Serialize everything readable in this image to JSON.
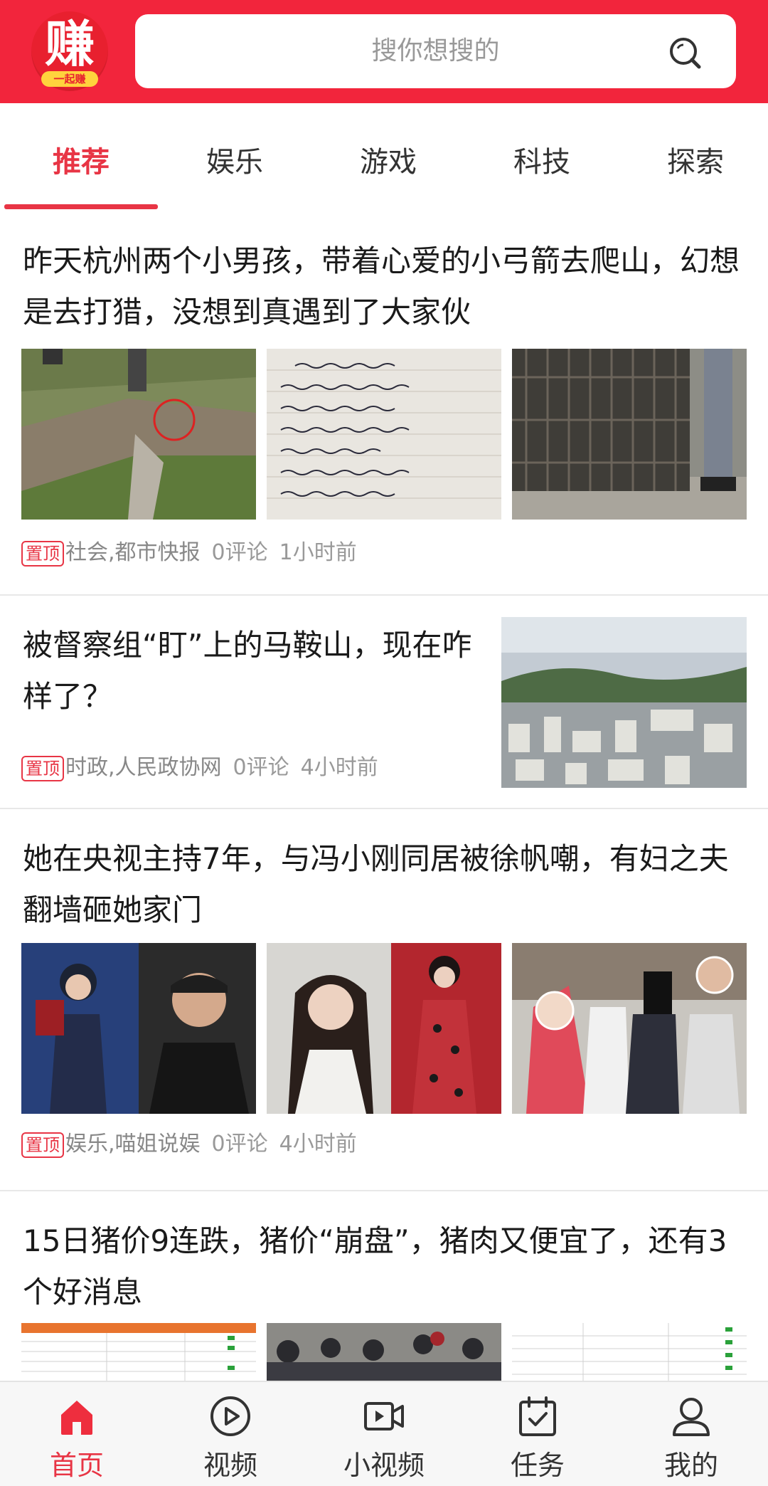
{
  "header": {
    "logo_main": "赚",
    "logo_sub": "一起赚",
    "search_placeholder": "搜你想搜的"
  },
  "tabs": [
    {
      "label": "推荐",
      "active": true
    },
    {
      "label": "娱乐",
      "active": false
    },
    {
      "label": "游戏",
      "active": false
    },
    {
      "label": "科技",
      "active": false
    },
    {
      "label": "探索",
      "active": false
    }
  ],
  "articles": [
    {
      "title": "昨天杭州两个小男孩，带着心爱的小弓箭去爬山，幻想是去打猎，没想到真遇到了大家伙",
      "badge": "置顶",
      "source": "社会,都市快报",
      "comments": "0评论",
      "time": "1小时前"
    },
    {
      "title": "被督察组“盯”上的马鞍山，现在咋样了？",
      "badge": "置顶",
      "source": "时政,人民政协网",
      "comments": "0评论",
      "time": "4小时前"
    },
    {
      "title": "她在央视主持7年，与冯小刚同居被徐帆嘲，有妇之夫翻墙砸她家门",
      "badge": "置顶",
      "source": "娱乐,喵姐说娱",
      "comments": "0评论",
      "time": "4小时前"
    },
    {
      "title": "15日猪价9连跌，猪价“崩盘”，猪肉又便宜了，还有3个好消息"
    }
  ],
  "bottom_nav": [
    {
      "label": "首页",
      "icon": "home-icon",
      "active": true
    },
    {
      "label": "视频",
      "icon": "play-circle-icon",
      "active": false
    },
    {
      "label": "小视频",
      "icon": "video-camera-icon",
      "active": false
    },
    {
      "label": "任务",
      "icon": "calendar-check-icon",
      "active": false
    },
    {
      "label": "我的",
      "icon": "user-icon",
      "active": false
    }
  ],
  "colors": {
    "brand_red": "#f2253c",
    "active_red": "#e83545",
    "logo_yellow": "#ffd33d"
  }
}
